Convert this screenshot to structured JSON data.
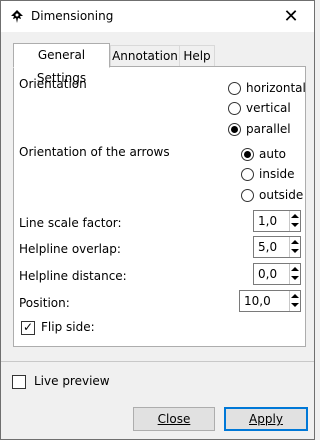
{
  "window": {
    "title": "Dimensioning",
    "app_icon": "inkscape-icon",
    "close_glyph": "✕"
  },
  "tabs": [
    {
      "label": "General Settings",
      "active": true
    },
    {
      "label": "Annotation",
      "active": false
    },
    {
      "label": "Help",
      "active": false
    }
  ],
  "general": {
    "orientation_label": "Orientation",
    "orientation_options": [
      {
        "label": "horizontal",
        "selected": false
      },
      {
        "label": "vertical",
        "selected": false
      },
      {
        "label": "parallel",
        "selected": true
      }
    ],
    "arrows_label": "Orientation of the arrows",
    "arrows_options": [
      {
        "label": "auto",
        "selected": true
      },
      {
        "label": "inside",
        "selected": false
      },
      {
        "label": "outside",
        "selected": false
      }
    ],
    "line_scale_label": "Line scale factor:",
    "line_scale_value": "1,0",
    "helpline_overlap_label": "Helpline overlap:",
    "helpline_overlap_value": "5,0",
    "helpline_distance_label": "Helpline distance:",
    "helpline_distance_value": "0,0",
    "position_label": "Position:",
    "position_value": "10,0",
    "flip_side_label": "Flip side:",
    "flip_side_checked": true
  },
  "footer": {
    "live_preview_label": "Live preview",
    "live_preview_checked": false,
    "close_label": "Close",
    "apply_label": "Apply"
  }
}
